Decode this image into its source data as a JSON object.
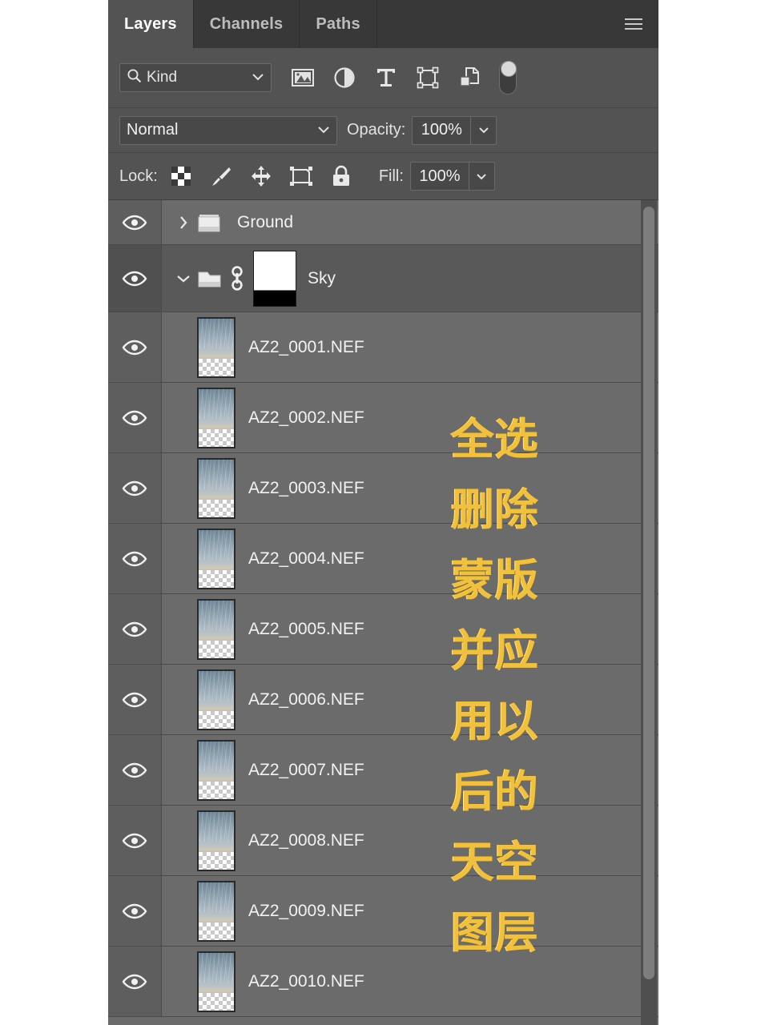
{
  "panel": {
    "accent_selected_row": "#595959",
    "accent_row": "#6b6b6b",
    "annotation_color": "#f0c040",
    "tabs": [
      {
        "label": "Layers",
        "active": true
      },
      {
        "label": "Channels",
        "active": false
      },
      {
        "label": "Paths",
        "active": false
      }
    ],
    "menu_icon": "hamburger-menu-icon"
  },
  "filter_row": {
    "search_icon": "search-icon",
    "kind_value": "Kind",
    "kind_chevron": "chevron-down-icon",
    "type_filters": [
      {
        "name": "pixel-layer-filter-icon"
      },
      {
        "name": "adjustment-layer-filter-icon"
      },
      {
        "name": "type-layer-filter-icon"
      },
      {
        "name": "shape-layer-filter-icon"
      },
      {
        "name": "smart-object-filter-icon"
      }
    ],
    "toggle": {
      "name": "filter-enable-toggle",
      "state": "on"
    }
  },
  "blend_row": {
    "blend_mode": "Normal",
    "blend_chevron": "chevron-down-icon",
    "opacity_label": "Opacity:",
    "opacity_value": "100%",
    "opacity_chevron": "chevron-down-icon"
  },
  "lock_row": {
    "lock_label": "Lock:",
    "lock_icons": [
      {
        "name": "lock-transparent-pixels-icon"
      },
      {
        "name": "lock-image-pixels-brush-icon"
      },
      {
        "name": "lock-position-move-icon"
      },
      {
        "name": "lock-artboard-nesting-icon"
      },
      {
        "name": "lock-all-padlock-icon"
      }
    ],
    "fill_label": "Fill:",
    "fill_value": "100%",
    "fill_chevron": "chevron-down-icon"
  },
  "layers": [
    {
      "kind": "group",
      "name": "Ground",
      "visible": true,
      "expanded": false,
      "selected": false,
      "chevron": "chevron-right-icon",
      "folder_icon": "folder-closed-icon"
    },
    {
      "kind": "group",
      "name": "Sky",
      "visible": true,
      "expanded": true,
      "selected": true,
      "chevron": "chevron-down-icon",
      "folder_icon": "folder-open-icon",
      "link_icon": "link-chain-icon",
      "mask": "layer-mask-white-black-thumbnail"
    },
    {
      "kind": "layer",
      "name": "AZ2_0001.NEF",
      "visible": true,
      "selected": false
    },
    {
      "kind": "layer",
      "name": "AZ2_0002.NEF",
      "visible": true,
      "selected": false
    },
    {
      "kind": "layer",
      "name": "AZ2_0003.NEF",
      "visible": true,
      "selected": false
    },
    {
      "kind": "layer",
      "name": "AZ2_0004.NEF",
      "visible": true,
      "selected": false
    },
    {
      "kind": "layer",
      "name": "AZ2_0005.NEF",
      "visible": true,
      "selected": false
    },
    {
      "kind": "layer",
      "name": "AZ2_0006.NEF",
      "visible": true,
      "selected": false
    },
    {
      "kind": "layer",
      "name": "AZ2_0007.NEF",
      "visible": true,
      "selected": false
    },
    {
      "kind": "layer",
      "name": "AZ2_0008.NEF",
      "visible": true,
      "selected": false
    },
    {
      "kind": "layer",
      "name": "AZ2_0009.NEF",
      "visible": true,
      "selected": false
    },
    {
      "kind": "layer",
      "name": "AZ2_0010.NEF",
      "visible": true,
      "selected": false
    }
  ],
  "annotation": {
    "full_text": "全选删除蒙版并应用以后的天空图层",
    "lines": [
      "全选",
      "删除",
      "蒙版",
      "并应",
      "用以",
      "后的",
      "天空",
      "图层"
    ]
  },
  "scrollbar": {
    "name": "vertical-scrollbar",
    "orientation": "vertical"
  }
}
